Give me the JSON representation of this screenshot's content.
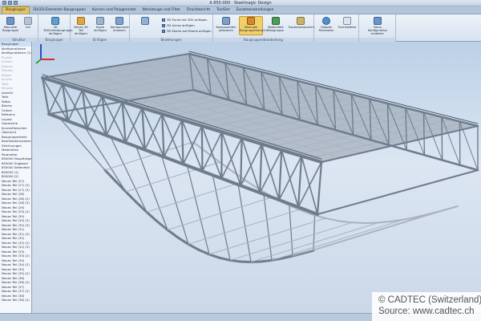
{
  "window": {
    "title": "A 850-000 · Steelmagic Design"
  },
  "tabs": [
    {
      "label": "Baugruppe",
      "active": true
    },
    {
      "label": "3D/2D-Elemente Baugruppen",
      "active": false
    },
    {
      "label": "Kurven und Polygonnetz",
      "active": false
    },
    {
      "label": "Werkzeuge und Filter",
      "active": false
    },
    {
      "label": "Druckbericht",
      "active": false
    },
    {
      "label": "ToolSet",
      "active": false
    },
    {
      "label": "Zusatzanwendungen",
      "active": false
    }
  ],
  "ribbon": {
    "groups": [
      {
        "label": "Struktur",
        "buttons": [
          "Manuelle Baugruppe",
          "Ext"
        ]
      },
      {
        "label": "Baugruppe",
        "buttons": [
          "3D Teil/Unterbaugruppe einfügen"
        ]
      },
      {
        "label": "Einfügen",
        "buttons": [
          "Neues 3D Teil einfügen",
          "Kopie einfügen",
          "Komponente ersetzen"
        ]
      },
      {
        "label": "Beziehungen",
        "rows": [
          "3D Punkt mit 3D2 anfügen",
          "3D Achse anfügen",
          "3D Ebene auf Ebene anfügen"
        ]
      },
      {
        "label": "Baugruppenbearbeitung",
        "buttons": [
          "Komponenten platzieren",
          "Minimale Baugruppenansicht",
          "Bedienfeld Baugruppe",
          "Explosionsansicht"
        ]
      },
      {
        "label": "",
        "buttons": [
          "Globale Parameter",
          "Formeleditor"
        ]
      },
      {
        "label": "",
        "buttons": [
          "Neue Konfiguration erstellen"
        ]
      }
    ]
  },
  "sidepanel": {
    "rows": [
      "Baugruppe",
      "Konfigurationen",
      "Konfigurationen (1)",
      "Punkte",
      "Achsen",
      "Ebenen",
      "Flächen",
      "Körper",
      "Kurven",
      "Teile",
      "Skizzen",
      "Ansicht",
      "Teile",
      "Stäbe",
      "Bleche",
      "Ordner",
      "Referenz",
      "Layout",
      "Geometrie",
      "Kurvenflanschen",
      "Übersicht",
      "Baugruppenteile",
      "Koordinatensysteme",
      "Zeichnungen",
      "Materialien",
      "Parameter",
      "850000 Hauptträger",
      "850000 Zugband",
      "850000 Seitenfeld",
      "800000 (1)",
      "800000 (2)",
      "Neues Teil (27)",
      "Neues Teil (27) (2)",
      "Neues Teil (27) (3)",
      "Neues Teil (28)",
      "Neues Teil (28) (2)",
      "Neues Teil (28) (3)",
      "Neues Teil (29)",
      "Neues Teil (29) (2)",
      "Neues Teil (30)",
      "Neues Teil (30) (2)",
      "Neues Teil (30) (3)",
      "Neues Teil (31)",
      "Neues Teil (31) (2)",
      "Neues Teil (32)",
      "Neues Teil (32) (2)",
      "Neues Teil (32) (3)",
      "Neues Teil (33)",
      "Neues Teil (33) (2)",
      "Neues Teil (34)",
      "Neues Teil (34) (2)",
      "Neues Teil (35)",
      "Neues Teil (35) (2)",
      "Neues Teil (36)",
      "Neues Teil (36) (2)",
      "Neues Teil (37)",
      "Neues Teil (37) (2)",
      "Neues Teil (38)",
      "Neues Teil (38) (2)"
    ],
    "dim_start": 3,
    "dim_end": 10
  },
  "watermark": {
    "line1": "© CADTEC (Switzerland) G",
    "line2": "Source: www.cadtec.ch"
  },
  "colors": {
    "steel": "#6f7c8c",
    "steel_light": "#a9b3bf",
    "deck": "#8893a0",
    "accent_tab": "#e5c25c"
  },
  "icons": [
    "save-icon",
    "undo-icon",
    "redo-icon",
    "assembly-icon",
    "part-icon",
    "axis-triad-icon"
  ]
}
